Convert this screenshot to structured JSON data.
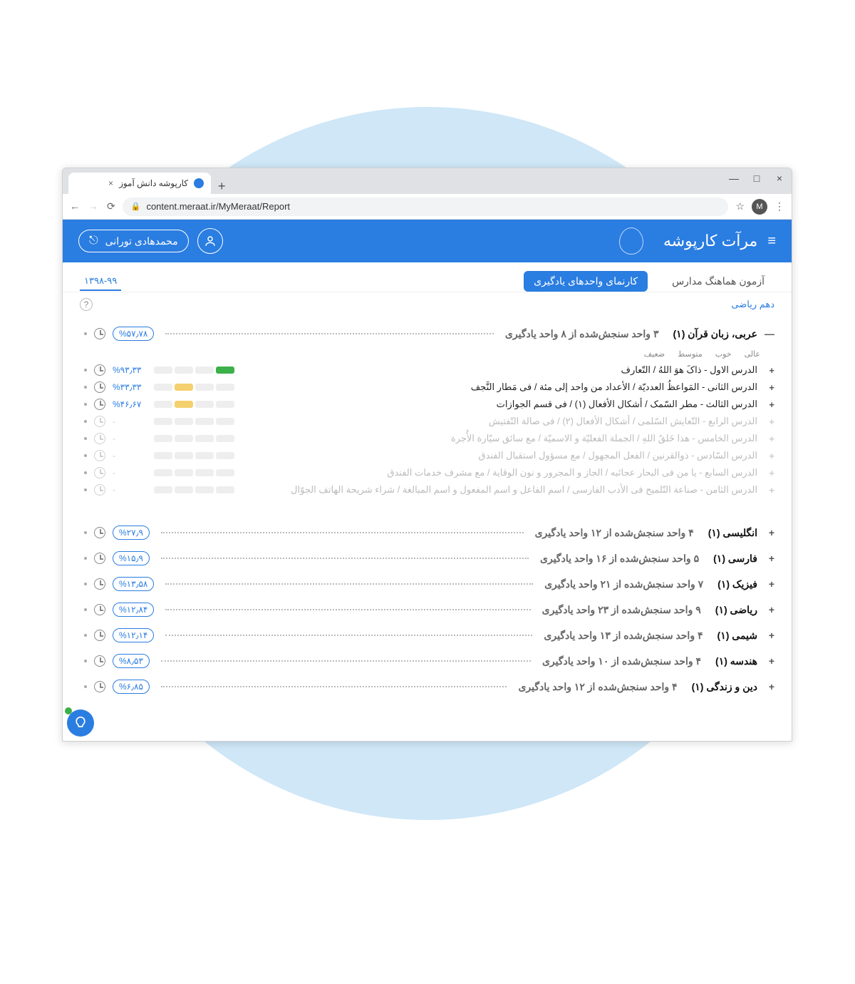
{
  "window": {
    "tab_title": "کارپوشه دانش آموز",
    "close": "×",
    "max": "□",
    "min": "—",
    "newtab": "+"
  },
  "address": {
    "url": "content.meraat.ir/MyMeraat/Report",
    "back": "←",
    "forward": "→",
    "reload": "⟳",
    "star": "☆",
    "avatar_letter": "M",
    "menu": "⋮"
  },
  "header": {
    "brand": "مرآت کارپوشه",
    "menu_icon": "≡",
    "user_name": "محمدهادی تورانی"
  },
  "tabs": {
    "left_year": "۱۳۹۸-۹۹",
    "main_tab": "آزمون هماهنگ مدارس",
    "active_tab": "کارنمای واحدهای یادگیری"
  },
  "subhead": {
    "grade": "دهم ریاضی",
    "help": "?"
  },
  "levels": {
    "l1": "عالی",
    "l2": "خوب",
    "l3": "متوسط",
    "l4": "ضعیف"
  },
  "arabic": {
    "title": "عربی، زبان قرآن (۱)",
    "note": "۳ واحد سنجش‌شده از ۸ واحد یادگیری",
    "pct": "%۵۷٫۷۸",
    "lessons": [
      {
        "title": "الدرس الاول - ذاکَ هوَ اللهُ / التّعارف",
        "pct": "%۹۳٫۳۳",
        "quality": "green",
        "disabled": false
      },
      {
        "title": "الدرس الثانی - المَواعظُ العددیّة / الأعداد من واحد إلی مئة / فی مَطار النَّجف",
        "pct": "%۳۳٫۳۳",
        "quality": "yellow",
        "disabled": false
      },
      {
        "title": "الدرس الثالث - مطر السّمک / أشکال الأفعال (۱) / فی قسم الجوازات",
        "pct": "%۴۶٫۶۷",
        "quality": "yellow",
        "disabled": false
      },
      {
        "title": "الدرس الرابع - التّعایش السّلمی / أشکال الأفعال (۲) / فی صالة التّفتیش",
        "pct": "-",
        "quality": "",
        "disabled": true
      },
      {
        "title": "الدرس الخامس - هذا خَلقُ اللهِ / الجملة الفعلیّة و الاسمیّة / مع سائق سیّارة الأُجرة",
        "pct": "-",
        "quality": "",
        "disabled": true
      },
      {
        "title": "الدرس السّادس - ذوالقرنین / الفعل المجهول / مع مسؤول استقبال الفندق",
        "pct": "-",
        "quality": "",
        "disabled": true
      },
      {
        "title": "الدرس السابع - یا من فی البحار عجائبه / الجاز و المجرور و نون الوقایة / مع مشرف خدمات الفندق",
        "pct": "-",
        "quality": "",
        "disabled": true
      },
      {
        "title": "الدرس الثامن - صناعة التّلمیح فی الأدب الفارسی / اسم الفاعل و اسم المفعول و اسم المبالغة / شراء شریحة الهاتف الجوّال",
        "pct": "-",
        "quality": "",
        "disabled": true
      }
    ]
  },
  "subjects": [
    {
      "title": "انگلیسی (۱)",
      "note": "۴ واحد سنجش‌شده از ۱۲ واحد یادگیری",
      "pct": "%۲۷٫۹"
    },
    {
      "title": "فارسی (۱)",
      "note": "۵ واحد سنجش‌شده از ۱۶ واحد یادگیری",
      "pct": "%۱۵٫۹"
    },
    {
      "title": "فیزیک (۱)",
      "note": "۷ واحد سنجش‌شده از ۲۱ واحد یادگیری",
      "pct": "%۱۳٫۵۸"
    },
    {
      "title": "ریاضی (۱)",
      "note": "۹ واحد سنجش‌شده از ۲۳ واحد یادگیری",
      "pct": "%۱۲٫۸۴"
    },
    {
      "title": "شیمی (۱)",
      "note": "۴ واحد سنجش‌شده از ۱۳ واحد یادگیری",
      "pct": "%۱۲٫۱۴"
    },
    {
      "title": "هندسه (۱)",
      "note": "۴ واحد سنجش‌شده از ۱۰ واحد یادگیری",
      "pct": "%۸٫۵۳"
    },
    {
      "title": "دین و زندگی (۱)",
      "note": "۴ واحد سنجش‌شده از ۱۲ واحد یادگیری",
      "pct": "%۶٫۸۵"
    }
  ]
}
